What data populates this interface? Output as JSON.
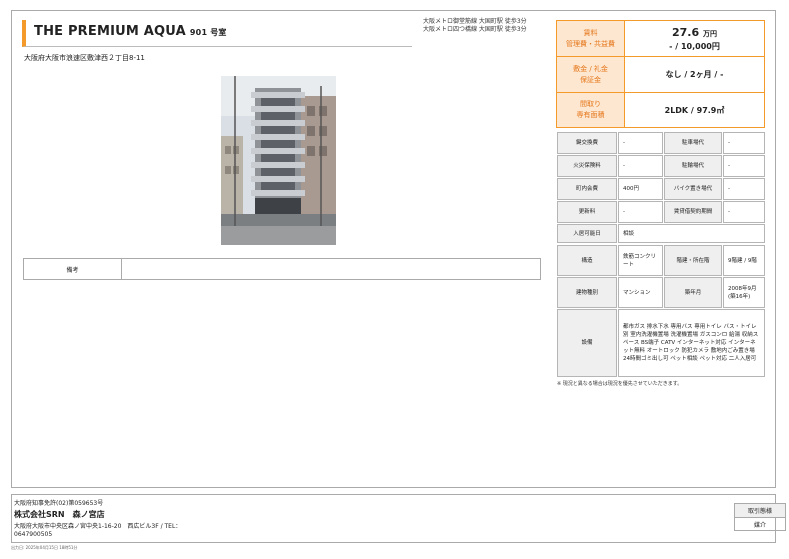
{
  "property": {
    "name": "THE PREMIUM AQUA",
    "room": "901 号室",
    "access": [
      "大阪メトロ御堂筋線 大国町駅 徒歩3分",
      "大阪メトロ四つ橋線 大国町駅 徒歩3分"
    ],
    "address": "大阪府大阪市浪速区敷津西２丁目8-11"
  },
  "highlights": {
    "rent_label_1": "賃料",
    "rent_label_2": "管理費・共益費",
    "rent_value": "27.6",
    "rent_unit": "万円",
    "fee_value": "- / 10,000円",
    "deposit_label_1": "敷金 / 礼金",
    "deposit_label_2": "保証金",
    "deposit_value": "なし / 2ヶ月 / -",
    "layout_label_1": "間取り",
    "layout_label_2": "専有面積",
    "layout_value": "2LDK / 97.9㎡"
  },
  "specs": {
    "key_exchange_label": "鍵交換費",
    "key_exchange_value": "-",
    "parking_label": "駐車場代",
    "parking_value": "-",
    "fire_ins_label": "火災保険料",
    "fire_ins_value": "-",
    "bicycle_label": "駐輪場代",
    "bicycle_value": "-",
    "community_label": "町内会費",
    "community_value": "400円",
    "bike_label": "バイク置き場代",
    "bike_value": "-",
    "renewal_label": "更新料",
    "renewal_value": "-",
    "lease_label": "賃貸借契約期間",
    "lease_value": "-",
    "move_in_label": "入居可能日",
    "move_in_value": "相談",
    "structure_label": "構造",
    "structure_value": "鉄筋コンクリート",
    "floor_label": "階建・所在階",
    "floor_value": "9階建 / 9階",
    "type_label": "建物種別",
    "type_value": "マンション",
    "built_label": "築年月",
    "built_value": "2008年9月(築16年)",
    "equip_label": "設備",
    "equip_value": "都市ガス 排水下水 専用バス 専用トイレ バス・トイレ別 室内洗濯機置場 洗濯機置場 ガスコンロ 給湯 収納スペース BS端子 CATV インターネット対応 インターネット無料 オートロック 防犯カメラ 敷地内ごみ置き場 24時間ゴミ出し可 ペット相談 ペット対応 二人入居可"
  },
  "remarks": {
    "label": "備考",
    "value": ""
  },
  "note": "※ 現況と異なる場合は現況を優先させていただきます。",
  "footer": {
    "license": "大阪府知事免許(02)第059653号",
    "company": "株式会社SRN　森ノ宮店",
    "address": "大阪府大阪市中央区森ノ宮中央1-16-20　西広ビル3F / TEL：0647900505",
    "deal_label": "取引態様",
    "deal_value": "媒介",
    "printed": "出力日: 2025年04月15日 18時51分"
  },
  "colors": {
    "accent": "#f39a2b",
    "accent_bg": "#fde7d0",
    "label_text": "#e5761a",
    "cell_bg": "#efefef"
  }
}
